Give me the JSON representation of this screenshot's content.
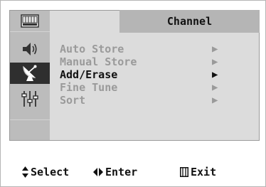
{
  "menu": {
    "title": "Channel",
    "items": [
      {
        "label": "Auto Store",
        "arrow": "▶",
        "selected": false
      },
      {
        "label": "Manual Store",
        "arrow": "▶",
        "selected": false
      },
      {
        "label": "Add/Erase",
        "arrow": "▶",
        "selected": true
      },
      {
        "label": "Fine Tune",
        "arrow": "▶",
        "selected": false
      },
      {
        "label": "Sort",
        "arrow": "▶",
        "selected": false
      }
    ]
  },
  "sidebar": {
    "icons": [
      "tv-input-icon",
      "speaker-sound-icon",
      "satellite-dish-channel-icon",
      "equalizer-setup-icon"
    ],
    "active_index": 2
  },
  "help": {
    "select_glyph": "⬍",
    "select_label": "Select",
    "enter_glyph": "◀▶",
    "enter_label": "Enter",
    "exit_glyph": "Ⅲ",
    "exit_label": "Exit"
  },
  "colors": {
    "panel": "#dcdcdc",
    "title_bar": "#b5b5b5",
    "icon_column": "#bcbcbc",
    "active_icon_bg": "#2f2f2f",
    "selected_text": "#111111",
    "dim_text": "#9a9a9a"
  }
}
